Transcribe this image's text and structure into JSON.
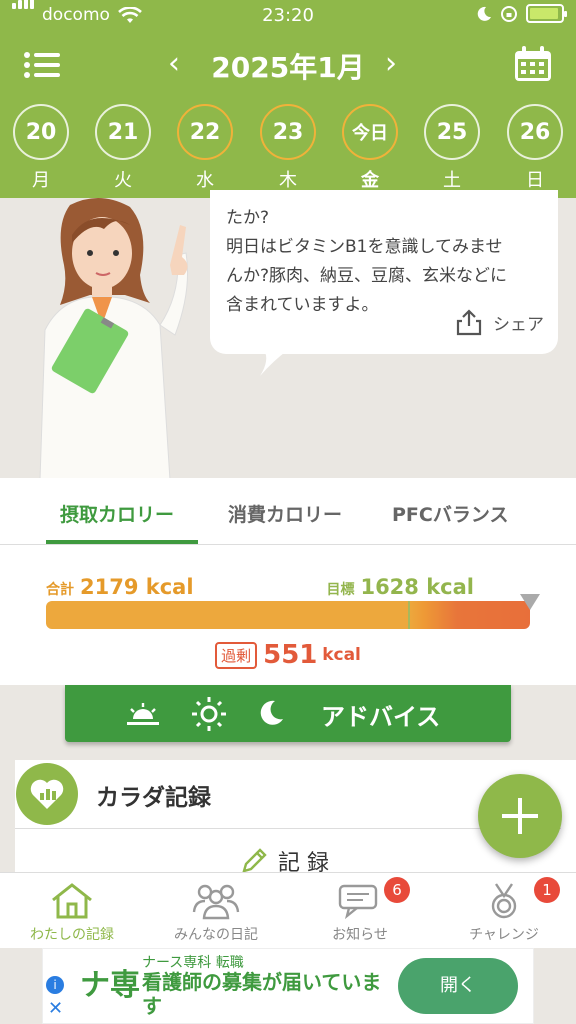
{
  "status_bar": {
    "carrier": "docomo",
    "time": "23:20"
  },
  "header": {
    "month_title": "2025年1月",
    "prev": "‹",
    "next": "›"
  },
  "days": [
    {
      "num": "20",
      "weekday": "月",
      "ring": "white"
    },
    {
      "num": "21",
      "weekday": "火",
      "ring": "white"
    },
    {
      "num": "22",
      "weekday": "水",
      "ring": "orange"
    },
    {
      "num": "23",
      "weekday": "木",
      "ring": "orange"
    },
    {
      "num": "今日",
      "weekday": "金",
      "ring": "orange",
      "selected": true
    },
    {
      "num": "25",
      "weekday": "土",
      "ring": "white"
    },
    {
      "num": "26",
      "weekday": "日",
      "ring": "white"
    }
  ],
  "advice_bubble": {
    "line1": "たか?",
    "line2": "明日はビタミンB1を意識してみませ",
    "line3": "んか?豚肉、納豆、豆腐、玄米などに",
    "line4": "含まれていますよ。",
    "share_label": "シェア"
  },
  "tabs": [
    {
      "label": "摂取カロリー",
      "active": true
    },
    {
      "label": "消費カロリー"
    },
    {
      "label": "PFCバランス"
    }
  ],
  "calorie": {
    "total_label": "合計",
    "total_value": "2179 kcal",
    "goal_label": "目標",
    "goal_value": "1628 kcal",
    "excess_badge": "過剰",
    "excess_value": "551",
    "excess_unit": "kcal",
    "goal_fraction": 0.747
  },
  "advice_button": {
    "label": "アドバイス"
  },
  "body_record": {
    "title": "カラダ記録",
    "record_label": "記 録"
  },
  "bottom_nav": [
    {
      "label": "わたしの記録",
      "active": true
    },
    {
      "label": "みんなの日記"
    },
    {
      "label": "お知らせ",
      "badge": "6"
    },
    {
      "label": "チャレンジ",
      "badge": "1"
    }
  ],
  "ad": {
    "subtitle": "ナース専科 転職",
    "title": "看護師の募集が届いています",
    "logo": "ナ専",
    "button": "開く",
    "info": "i",
    "close": "✕"
  },
  "colors": {
    "header_green": "#8fb84a",
    "accent_green": "#3f9a3f",
    "orange": "#eda83d",
    "red": "#e25a3a"
  }
}
